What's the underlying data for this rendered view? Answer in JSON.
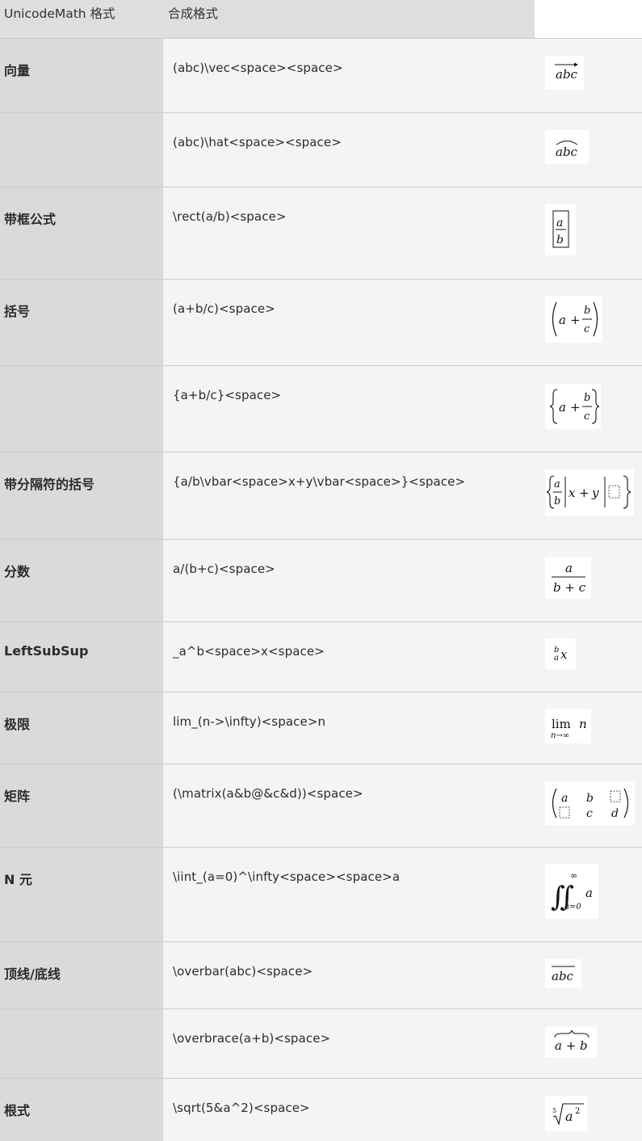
{
  "header": {
    "col1": "UnicodeMath 格式",
    "col2": "合成格式"
  },
  "rows": [
    {
      "category": "向量",
      "code": "(abc)\\vec<space><space>",
      "render": "abc"
    },
    {
      "category": "",
      "code": "(abc)\\hat<space><space>",
      "render": "abc"
    },
    {
      "category": "带框公式",
      "code": "\\rect(a/b)<space>",
      "render": "a/b"
    },
    {
      "category": "括号",
      "code": "(a+b/c)<space>",
      "render": "(a+b/c)"
    },
    {
      "category": "",
      "code": "{a+b/c}<space>",
      "render": "{a+b/c}"
    },
    {
      "category": "带分隔符的括号",
      "code": "{a/b\\vbar<space>x+y\\vbar<space>}<space>",
      "render": "{a/b|x+y|}"
    },
    {
      "category": "分数",
      "code": "a/(b+c)<space>",
      "render": "a/(b+c)"
    },
    {
      "category": "LeftSubSup",
      "code": "_a^b<space>x<space>",
      "render": "_a^b x"
    },
    {
      "category": "极限",
      "code": "lim_(n->\\infty)<space>n",
      "render": "lim n, n→∞"
    },
    {
      "category": "矩阵",
      "code": "(\\matrix(a&b@&c&d))<space>",
      "render": "matrix a b c d"
    },
    {
      "category": "N 元",
      "code": "\\iint_(a=0)^\\infty<space><space>a",
      "render": "∬ a=0 ∞ a"
    },
    {
      "category": "顶线/底线",
      "code": "\\overbar(abc)<space>",
      "render": "abc"
    },
    {
      "category": "",
      "code": "\\overbrace(a+b)<space>",
      "render": "a+b"
    },
    {
      "category": "根式",
      "code": "\\sqrt(5&a^2)<space>",
      "render": "5 a 2"
    }
  ],
  "math": {
    "abc": "abc",
    "a": "a",
    "b": "b",
    "c": "c",
    "d": "d",
    "plus": "+",
    "x": "x",
    "y": "y",
    "bplusc": "b + c",
    "lim": "lim",
    "n": "n",
    "ninf": "n→∞",
    "iint": "∬",
    "inf": "∞",
    "a0": "a=0",
    "aplusb": "a + b",
    "five": "5",
    "two": "2",
    "arrow": "→"
  }
}
